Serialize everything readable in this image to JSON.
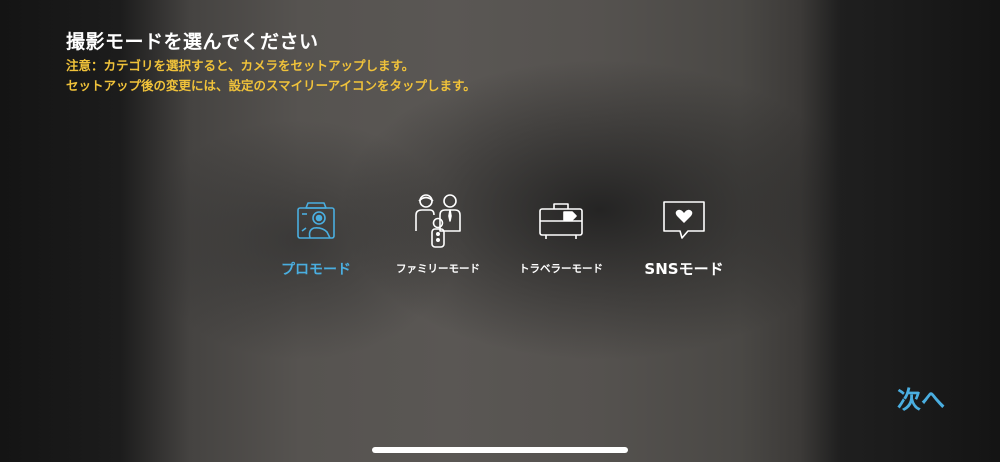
{
  "header": {
    "title": "撮影モードを選んでください",
    "notice_line1": "注意：カテゴリを選択すると、カメラをセットアップします。",
    "notice_line2": "セットアップ後の変更には、設定のスマイリーアイコンをタップします。"
  },
  "modes": [
    {
      "label": "プロモード",
      "icon": "camera-icon",
      "selected": true
    },
    {
      "label": "ファミリーモード",
      "icon": "family-icon",
      "selected": false
    },
    {
      "label": "トラベラーモード",
      "icon": "suitcase-icon",
      "selected": false
    },
    {
      "label": "SNSモード",
      "icon": "heart-speech-bubble-icon",
      "selected": false
    }
  ],
  "footer": {
    "next_label": "次へ"
  },
  "colors": {
    "accent": "#4aaee0",
    "notice": "#f0c23a",
    "text": "#ffffff"
  }
}
